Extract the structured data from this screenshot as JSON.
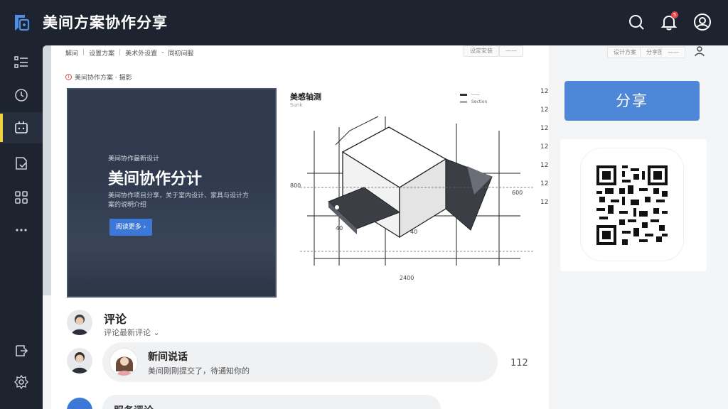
{
  "app": {
    "title": "美间方案协作分享",
    "notification_count": "5"
  },
  "icons": {
    "logo": "app-logo-icon",
    "search": "search-icon",
    "bell": "bell-icon",
    "user": "user-circle-icon"
  },
  "sidebar": {
    "items": [
      {
        "name": "list-icon",
        "active": false
      },
      {
        "name": "clock-icon",
        "active": false
      },
      {
        "name": "share-board-icon",
        "active": true
      },
      {
        "name": "document-icon",
        "active": false
      },
      {
        "name": "grid-icon",
        "active": false
      },
      {
        "name": "more-icon",
        "active": false
      },
      {
        "name": "export-icon",
        "active": false
      },
      {
        "name": "settings-icon",
        "active": false
      }
    ]
  },
  "toolbar": {
    "crumbs": [
      "解间",
      "设置方案",
      "美术外设置",
      "-",
      "同初间服"
    ],
    "chip1": "设定安装",
    "chip2": "——",
    "right_chip1": "设计方案",
    "right_chip2": "分享图片",
    "right_chip3": "——"
  },
  "path": {
    "icon": "i",
    "text": "美间协作方案 · 摄影"
  },
  "preview": {
    "kicker": "美间协作最新设计",
    "title": "美间协作分计",
    "desc": "美间协作项目分享，关于室内设计、家具与设计方案的说明介绍",
    "button": "阅读更多 ›"
  },
  "drawing": {
    "title": "美感轴测",
    "subtitle": "Sunk",
    "legend": [
      "——",
      "Section"
    ],
    "dims": {
      "left": "800",
      "right": "600",
      "bottom": "2400",
      "w1": "40",
      "w2": "40"
    }
  },
  "ruler": [
    "12",
    "12",
    "12",
    "12",
    "12",
    "12",
    "12"
  ],
  "comments": {
    "header_title": "评论",
    "header_sort": "评论最新评论",
    "items": [
      {
        "title": "新间说话",
        "text": "美间刚刚提交了，待通知你的",
        "count": "112"
      },
      {
        "title": "服务评论",
        "text": "",
        "count": "……"
      }
    ]
  },
  "share": {
    "button": "分享"
  },
  "colors": {
    "accent": "#4e87d8",
    "active_marker": "#f2d03b",
    "sidebar_bg": "#1e2330",
    "notification": "#e8414a"
  }
}
